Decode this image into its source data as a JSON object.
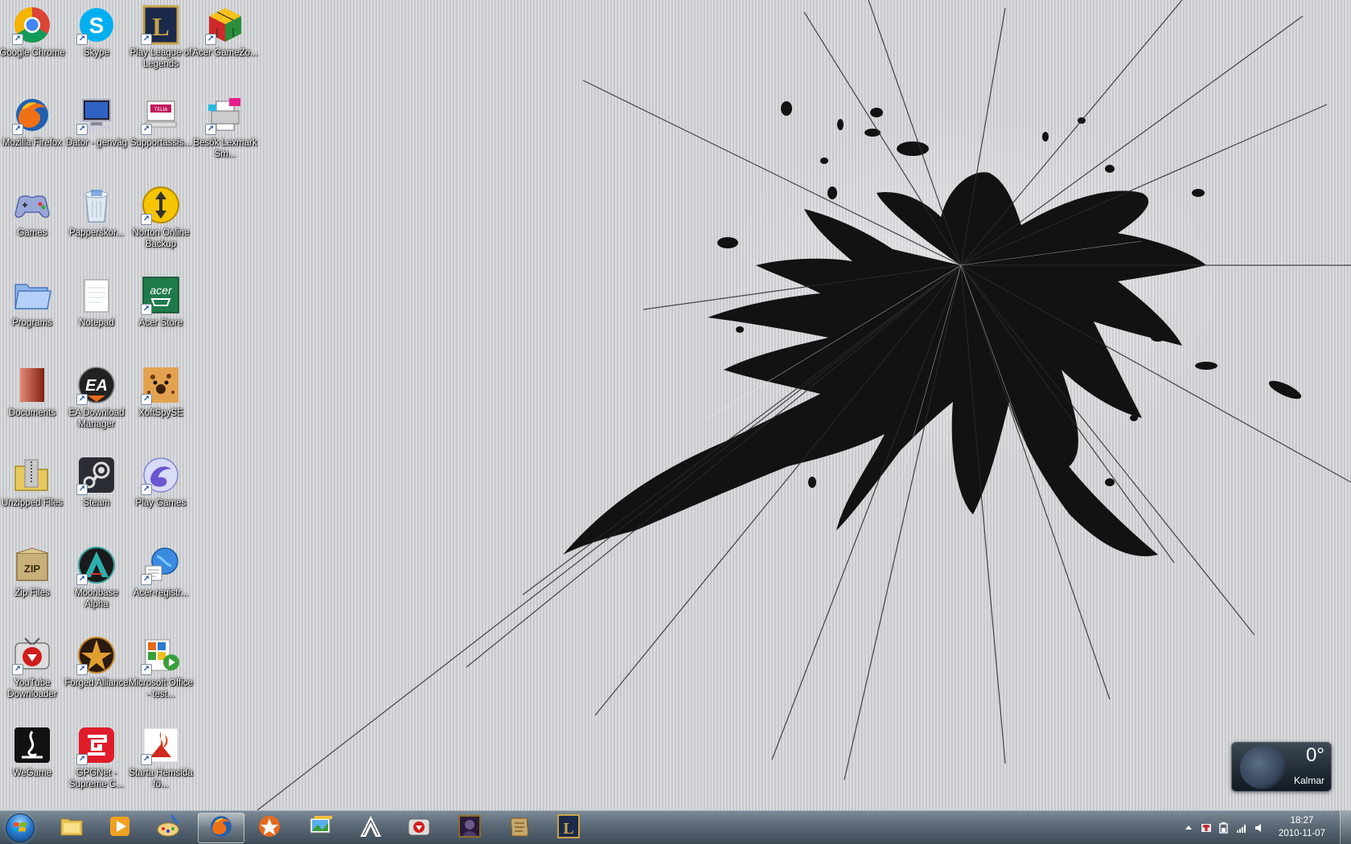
{
  "desktop": {
    "icons": [
      {
        "label": "Google Chrome",
        "icon": "chrome-icon",
        "shortcut": true
      },
      {
        "label": "Skype",
        "icon": "skype-icon",
        "shortcut": true
      },
      {
        "label": "Play League of Legends",
        "icon": "league-icon",
        "shortcut": true
      },
      {
        "label": "Acer GameZo...",
        "icon": "cube-icon",
        "shortcut": true
      },
      {
        "label": "Mozilla Firefox",
        "icon": "firefox-icon",
        "shortcut": true
      },
      {
        "label": "Dator - genväg",
        "icon": "computer-icon",
        "shortcut": true
      },
      {
        "label": "Supportassis...",
        "icon": "support-icon",
        "shortcut": true
      },
      {
        "label": "Besök Lexmark Sm...",
        "icon": "printer-icon",
        "shortcut": true
      },
      {
        "label": "Games",
        "icon": "gamepad-icon",
        "shortcut": false
      },
      {
        "label": "Papperskor...",
        "icon": "recycle-bin-icon",
        "shortcut": false
      },
      {
        "label": "Norton Online Backup",
        "icon": "norton-icon",
        "shortcut": true
      },
      {
        "label": "",
        "icon": "",
        "shortcut": false
      },
      {
        "label": "Programs",
        "icon": "folder-icon",
        "shortcut": false
      },
      {
        "label": "Notepad",
        "icon": "notepad-icon",
        "shortcut": false
      },
      {
        "label": "Acer Store",
        "icon": "acer-store-icon",
        "shortcut": true
      },
      {
        "label": "",
        "icon": "",
        "shortcut": false
      },
      {
        "label": "Documents",
        "icon": "documents-icon",
        "shortcut": false
      },
      {
        "label": "EA Download Manager",
        "icon": "ea-icon",
        "shortcut": true
      },
      {
        "label": "XoftSpySE",
        "icon": "cheetah-icon",
        "shortcut": true
      },
      {
        "label": "",
        "icon": "",
        "shortcut": false
      },
      {
        "label": "Unzipped Files",
        "icon": "archive-folder-icon",
        "shortcut": false
      },
      {
        "label": "Steam",
        "icon": "steam-icon",
        "shortcut": true
      },
      {
        "label": "Play Games",
        "icon": "play-games-icon",
        "shortcut": true
      },
      {
        "label": "",
        "icon": "",
        "shortcut": false
      },
      {
        "label": "Zip Files",
        "icon": "zip-icon",
        "shortcut": false
      },
      {
        "label": "Moonbase Alpha",
        "icon": "moonbase-icon",
        "shortcut": true
      },
      {
        "label": "Acer-registr...",
        "icon": "globe-icon",
        "shortcut": true
      },
      {
        "label": "",
        "icon": "",
        "shortcut": false
      },
      {
        "label": "YouTube Downloader",
        "icon": "youtube-downloader-icon",
        "shortcut": true
      },
      {
        "label": "Forged Alliance",
        "icon": "forged-alliance-icon",
        "shortcut": true
      },
      {
        "label": "Microsoft Office - test...",
        "icon": "office-icon",
        "shortcut": true
      },
      {
        "label": "",
        "icon": "",
        "shortcut": false
      },
      {
        "label": "WeGame",
        "icon": "wegame-icon",
        "shortcut": false
      },
      {
        "label": "GPGNet - Supreme C...",
        "icon": "gpgnet-icon",
        "shortcut": true
      },
      {
        "label": "Starta Hemsida fö...",
        "icon": "home-page-icon",
        "shortcut": true
      }
    ]
  },
  "weather": {
    "temp": "0°",
    "city": "Kalmar"
  },
  "taskbar": {
    "pinned": [
      {
        "icon": "explorer-icon",
        "active": false
      },
      {
        "icon": "media-player-icon",
        "active": false
      },
      {
        "icon": "paint-icon",
        "active": false
      },
      {
        "icon": "firefox-icon",
        "active": true
      },
      {
        "icon": "gpgnet-task-icon",
        "active": false
      },
      {
        "icon": "photo-gallery-icon",
        "active": false
      },
      {
        "icon": "moonbase-task-icon",
        "active": false
      },
      {
        "icon": "youtube-task-icon",
        "active": false
      },
      {
        "icon": "game-portrait-icon",
        "active": false
      },
      {
        "icon": "scroll-icon",
        "active": false
      },
      {
        "icon": "league-task-icon",
        "active": false
      }
    ],
    "clock": {
      "time": "18:27",
      "date": "2010-11-07"
    }
  },
  "colors": {
    "taskbar": "#5a6976",
    "label_text": "#ffffff",
    "weather_bg": "#202a33"
  }
}
